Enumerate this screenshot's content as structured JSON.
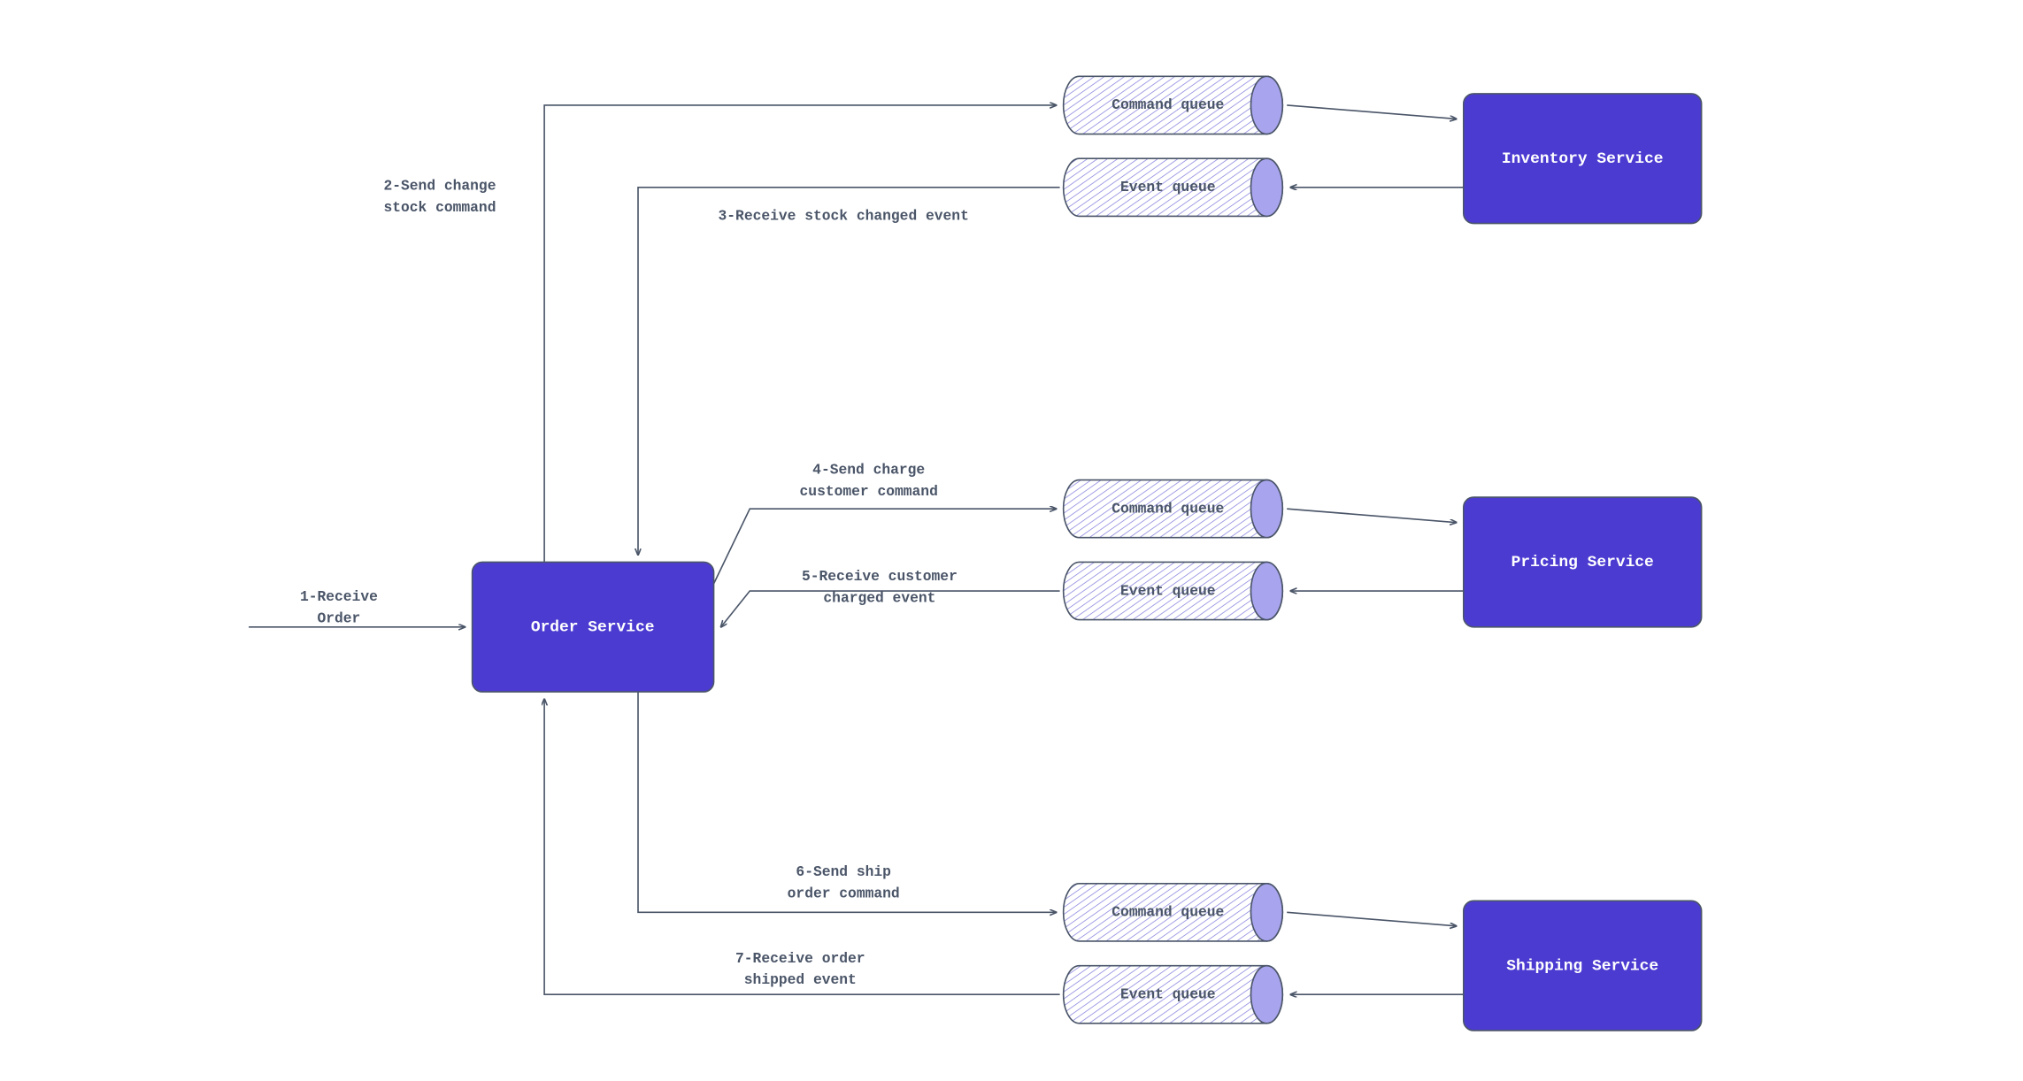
{
  "orderService": {
    "label": "Order Service"
  },
  "services": {
    "inventory": {
      "label": "Inventory Service"
    },
    "pricing": {
      "label": "Pricing Service"
    },
    "shipping": {
      "label": "Shipping Service"
    }
  },
  "queues": {
    "inventoryCmd": {
      "label": "Command queue"
    },
    "inventoryEvt": {
      "label": "Event queue"
    },
    "pricingCmd": {
      "label": "Command queue"
    },
    "pricingEvt": {
      "label": "Event queue"
    },
    "shippingCmd": {
      "label": "Command queue"
    },
    "shippingEvt": {
      "label": "Event queue"
    }
  },
  "edges": {
    "receiveOrder": {
      "l1": "1-Receive",
      "l2": "Order"
    },
    "sendChangeStock": {
      "l1": "2-Send change",
      "l2": "stock command"
    },
    "receiveStockChanged": {
      "l1": "3-Receive stock changed event"
    },
    "sendCharge": {
      "l1": "4-Send charge",
      "l2": "customer command"
    },
    "receiveCharged": {
      "l1": "5-Receive customer",
      "l2": "charged event"
    },
    "sendShip": {
      "l1": "6-Send ship",
      "l2": "order command"
    },
    "receiveShipped": {
      "l1": "7-Receive order",
      "l2": "shipped event"
    }
  }
}
